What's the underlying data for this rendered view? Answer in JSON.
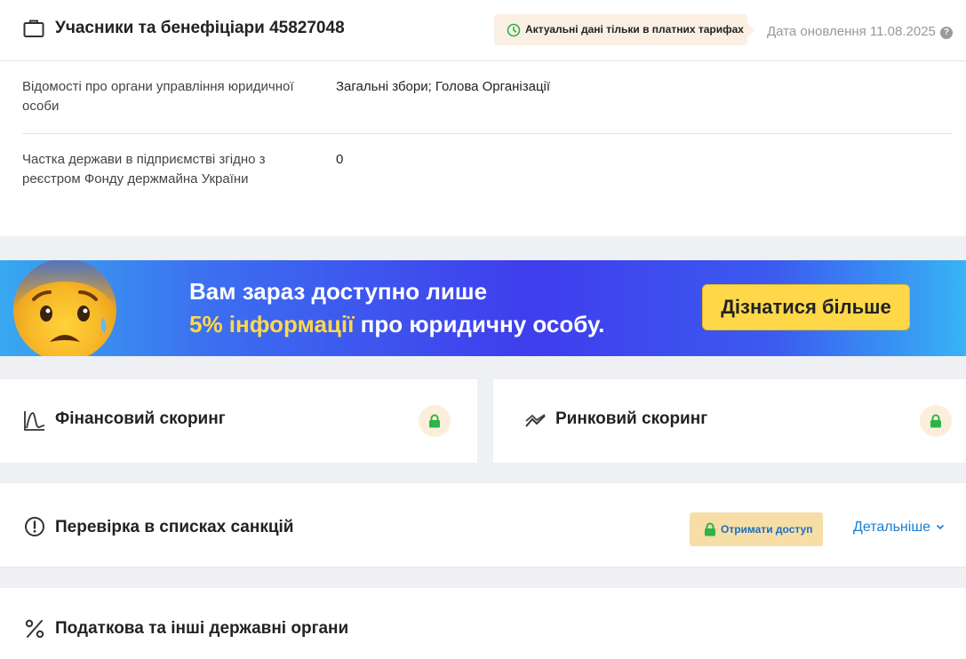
{
  "participants": {
    "title": "Учасники та бенефіціари 45827048",
    "badge_text": "Актуальні дані тільки в платних тарифах",
    "update_date": "Дата оновлення 11.08.2025",
    "help_glyph": "?",
    "rows": [
      {
        "label": "Відомості про органи управління юридичної особи",
        "value": "Загальні збори; Голова Організації"
      },
      {
        "label": "Частка держави в підприємстві згідно з реєстром Фонду держмайна України",
        "value": "0"
      }
    ]
  },
  "promo": {
    "line1": "Вам зараз доступно лише",
    "highlight": "5% інформації",
    "line2_rest": " про юридичну особу.",
    "button": "Дізнатися більше",
    "highlight_color": "#ffd84a"
  },
  "scoring": {
    "financial": {
      "title": "Фінансовий скоринг",
      "icon": "chart-line-icon"
    },
    "market": {
      "title": "Ринковий скоринг",
      "icon": "trend-icon"
    }
  },
  "sanctions": {
    "title": "Перевірка в списках санкцій",
    "access_button": "Отримати доступ",
    "details_link": "Детальніше"
  },
  "tax": {
    "title": "Податкова та інші державні органи"
  },
  "colors": {
    "accent_blue": "#1a7fd4",
    "lock_green": "#2db34a",
    "button_yellow": "#ffd84a"
  }
}
